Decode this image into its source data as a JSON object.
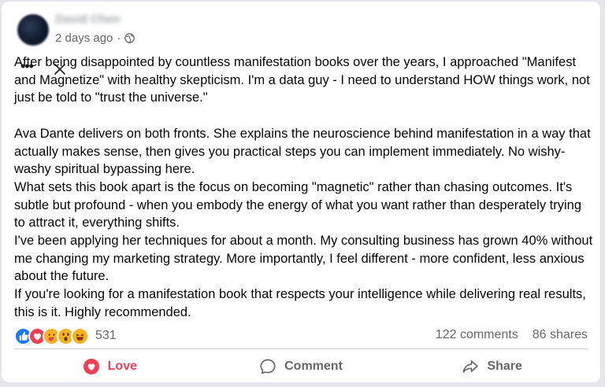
{
  "post": {
    "author": "David Chen",
    "timestamp": "2 days ago",
    "separator": "·",
    "privacy_icon": "globe-icon",
    "body": "After being disappointed by countless manifestation books over the years, I approached \"Manifest and Magnetize\" with healthy skepticism. I'm a data guy - I need to understand HOW things work, not just be told to \"trust the universe.\"\n\nAva Dante delivers on both fronts. She explains the neuroscience behind manifestation in a way that actually makes sense, then gives you practical steps you can implement immediately. No wishy-washy spiritual bypassing here.\nWhat sets this book apart is the focus on becoming \"magnetic\" rather than chasing outcomes. It's subtle but profound - when you embody the energy of what you want rather than desperately trying to attract it, everything shifts.\nI've been applying her techniques for about a month. My consulting business has grown 40% without me changing my marketing strategy. More importantly, I feel different - more confident, less anxious about the future.\nIf you're looking for a manifestation book that respects your intelligence while delivering real results, this is it. Highly recommended."
  },
  "overlay": {
    "more_icon": "more-horizontal-icon",
    "more_glyph": "•••",
    "close_icon": "close-icon"
  },
  "reactions": {
    "icons": [
      "like-icon",
      "love-icon",
      "care-icon",
      "wow-icon",
      "haha-icon"
    ],
    "count": "531"
  },
  "stats": {
    "comments": "122 comments",
    "shares": "86 shares"
  },
  "actions": {
    "love_label": "Love",
    "comment_label": "Comment",
    "share_label": "Share"
  },
  "colors": {
    "love_accent": "#f33e58",
    "like_blue": "#1877f2",
    "muted_text": "#65676b"
  }
}
